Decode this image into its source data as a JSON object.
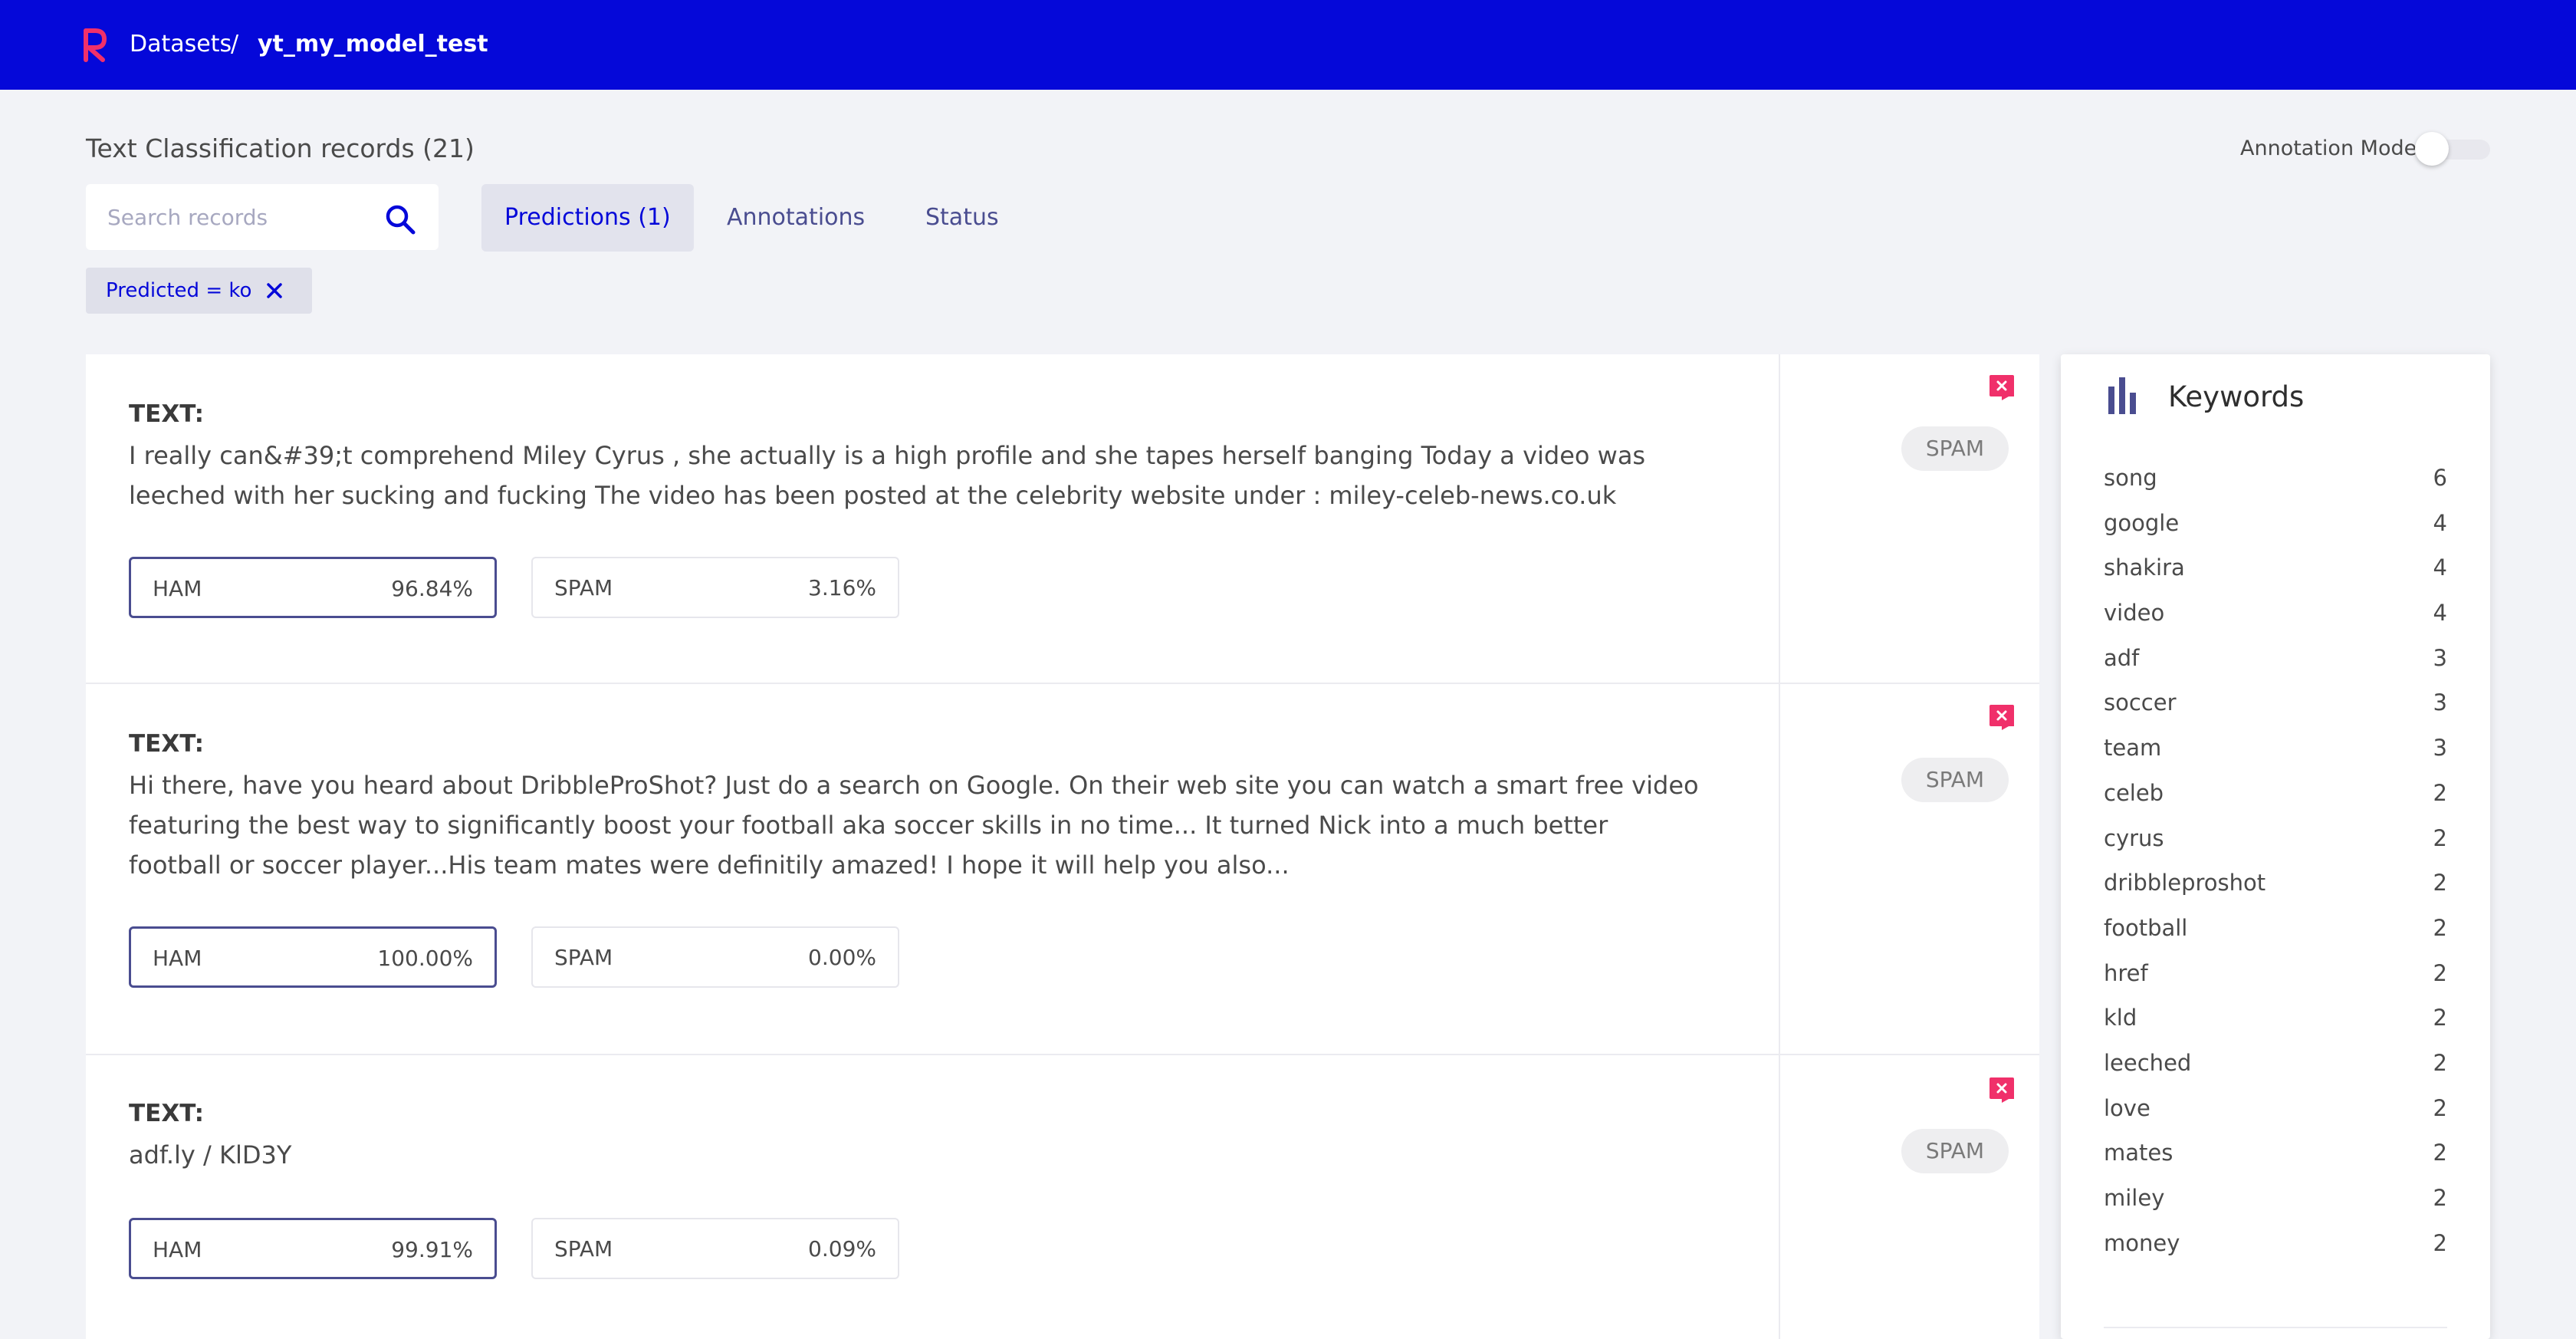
{
  "header": {
    "breadcrumb_root": "Datasets",
    "separator": "/",
    "dataset_name": "yt_my_model_test"
  },
  "page": {
    "title": "Text Classification records (21)",
    "annotation_mode_label": "Annotation Mode",
    "annotation_mode_on": false
  },
  "search": {
    "placeholder": "Search records",
    "value": ""
  },
  "tabs": [
    {
      "label": "Predictions (1)",
      "active": true
    },
    {
      "label": "Annotations",
      "active": false
    },
    {
      "label": "Status",
      "active": false
    }
  ],
  "filter_chip": {
    "label": "Predicted = ko"
  },
  "records": [
    {
      "text_label": "TEXT:",
      "text": "I really can&#39;t comprehend Miley Cyrus , she actually is a high profile and she tapes herself banging Today a video was leeched with her sucking and fucking The video has been posted at the celebrity website under : miley-celeb-news.co.uk",
      "predictions": [
        {
          "label": "HAM",
          "value": "96.84%"
        },
        {
          "label": "SPAM",
          "value": "3.16%"
        }
      ],
      "annotation": "SPAM"
    },
    {
      "text_label": "TEXT:",
      "text": "Hi there, have you heard about DribbleProShot? Just do a search on Google. On their web site you can watch a smart free video featuring the best way to significantly boost your football aka soccer skills in no time... It turned Nick into a much better football or soccer player...His team mates were definitily amazed! I hope it will help you also...",
      "predictions": [
        {
          "label": "HAM",
          "value": "100.00%"
        },
        {
          "label": "SPAM",
          "value": "0.00%"
        }
      ],
      "annotation": "SPAM"
    },
    {
      "text_label": "TEXT:",
      "text": "adf.ly / KlD3Y",
      "predictions": [
        {
          "label": "HAM",
          "value": "99.91%"
        },
        {
          "label": "SPAM",
          "value": "0.09%"
        }
      ],
      "annotation": "SPAM"
    }
  ],
  "keywords": {
    "title": "Keywords",
    "items": [
      {
        "word": "song",
        "count": "6"
      },
      {
        "word": "google",
        "count": "4"
      },
      {
        "word": "shakira",
        "count": "4"
      },
      {
        "word": "video",
        "count": "4"
      },
      {
        "word": "adf",
        "count": "3"
      },
      {
        "word": "soccer",
        "count": "3"
      },
      {
        "word": "team",
        "count": "3"
      },
      {
        "word": "celeb",
        "count": "2"
      },
      {
        "word": "cyrus",
        "count": "2"
      },
      {
        "word": "dribbleproshot",
        "count": "2"
      },
      {
        "word": "football",
        "count": "2"
      },
      {
        "word": "href",
        "count": "2"
      },
      {
        "word": "kld",
        "count": "2"
      },
      {
        "word": "leeched",
        "count": "2"
      },
      {
        "word": "love",
        "count": "2"
      },
      {
        "word": "mates",
        "count": "2"
      },
      {
        "word": "miley",
        "count": "2"
      },
      {
        "word": "money",
        "count": "2"
      }
    ]
  },
  "colors": {
    "header_bg": "#0508d9",
    "accent": "#0508d9",
    "logo_pink": "#f0306a",
    "flag_pink": "#f0306a",
    "keyword_icon": "#4a4d90"
  },
  "icons": {
    "logo": "rubrix-logo",
    "search": "search-icon",
    "chip_close": "close-icon",
    "flag": "flag-icon",
    "keywords": "bar-chart-icon"
  }
}
